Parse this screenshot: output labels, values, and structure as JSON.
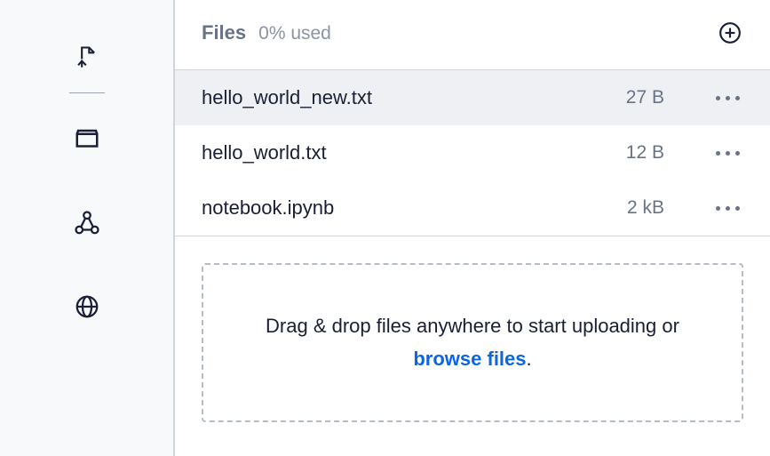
{
  "sidebar": {
    "icons": [
      "upload-file",
      "files",
      "share",
      "globe"
    ]
  },
  "header": {
    "title": "Files",
    "usage": "0% used"
  },
  "files": [
    {
      "name": "hello_world_new.txt",
      "size": "27 B",
      "selected": true
    },
    {
      "name": "hello_world.txt",
      "size": "12 B",
      "selected": false
    },
    {
      "name": "notebook.ipynb",
      "size": "2 kB",
      "selected": false
    }
  ],
  "dropzone": {
    "text_prefix": "Drag & drop files anywhere to start uploading or ",
    "link": "browse files",
    "text_suffix": "."
  }
}
